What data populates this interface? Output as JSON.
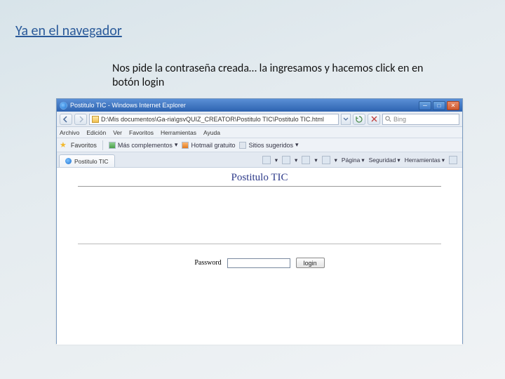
{
  "slide": {
    "title": "Ya en el navegador",
    "description": "Nos pide la contraseña creada… la ingresamos y hacemos click en en botón login"
  },
  "browser": {
    "window_title": "Postitulo TIC - Windows Internet Explorer",
    "address": "D:\\Mis documentos\\Ga-ria\\gsvQUIZ_CREATOR\\Postitulo TIC\\Postitulo TIC.html",
    "search_placeholder": "Bing",
    "menu": [
      "Archivo",
      "Edición",
      "Ver",
      "Favoritos",
      "Herramientas",
      "Ayuda"
    ],
    "favorites_label": "Favoritos",
    "fav_links": [
      "Más complementos",
      "Hotmail gratuito",
      "Sitios sugeridos"
    ],
    "tab_label": "Postitulo TIC",
    "toolbar": [
      "Página",
      "Seguridad",
      "Herramientas"
    ]
  },
  "page": {
    "title": "Postitulo TIC",
    "password_label": "Password",
    "login_button": "login"
  }
}
